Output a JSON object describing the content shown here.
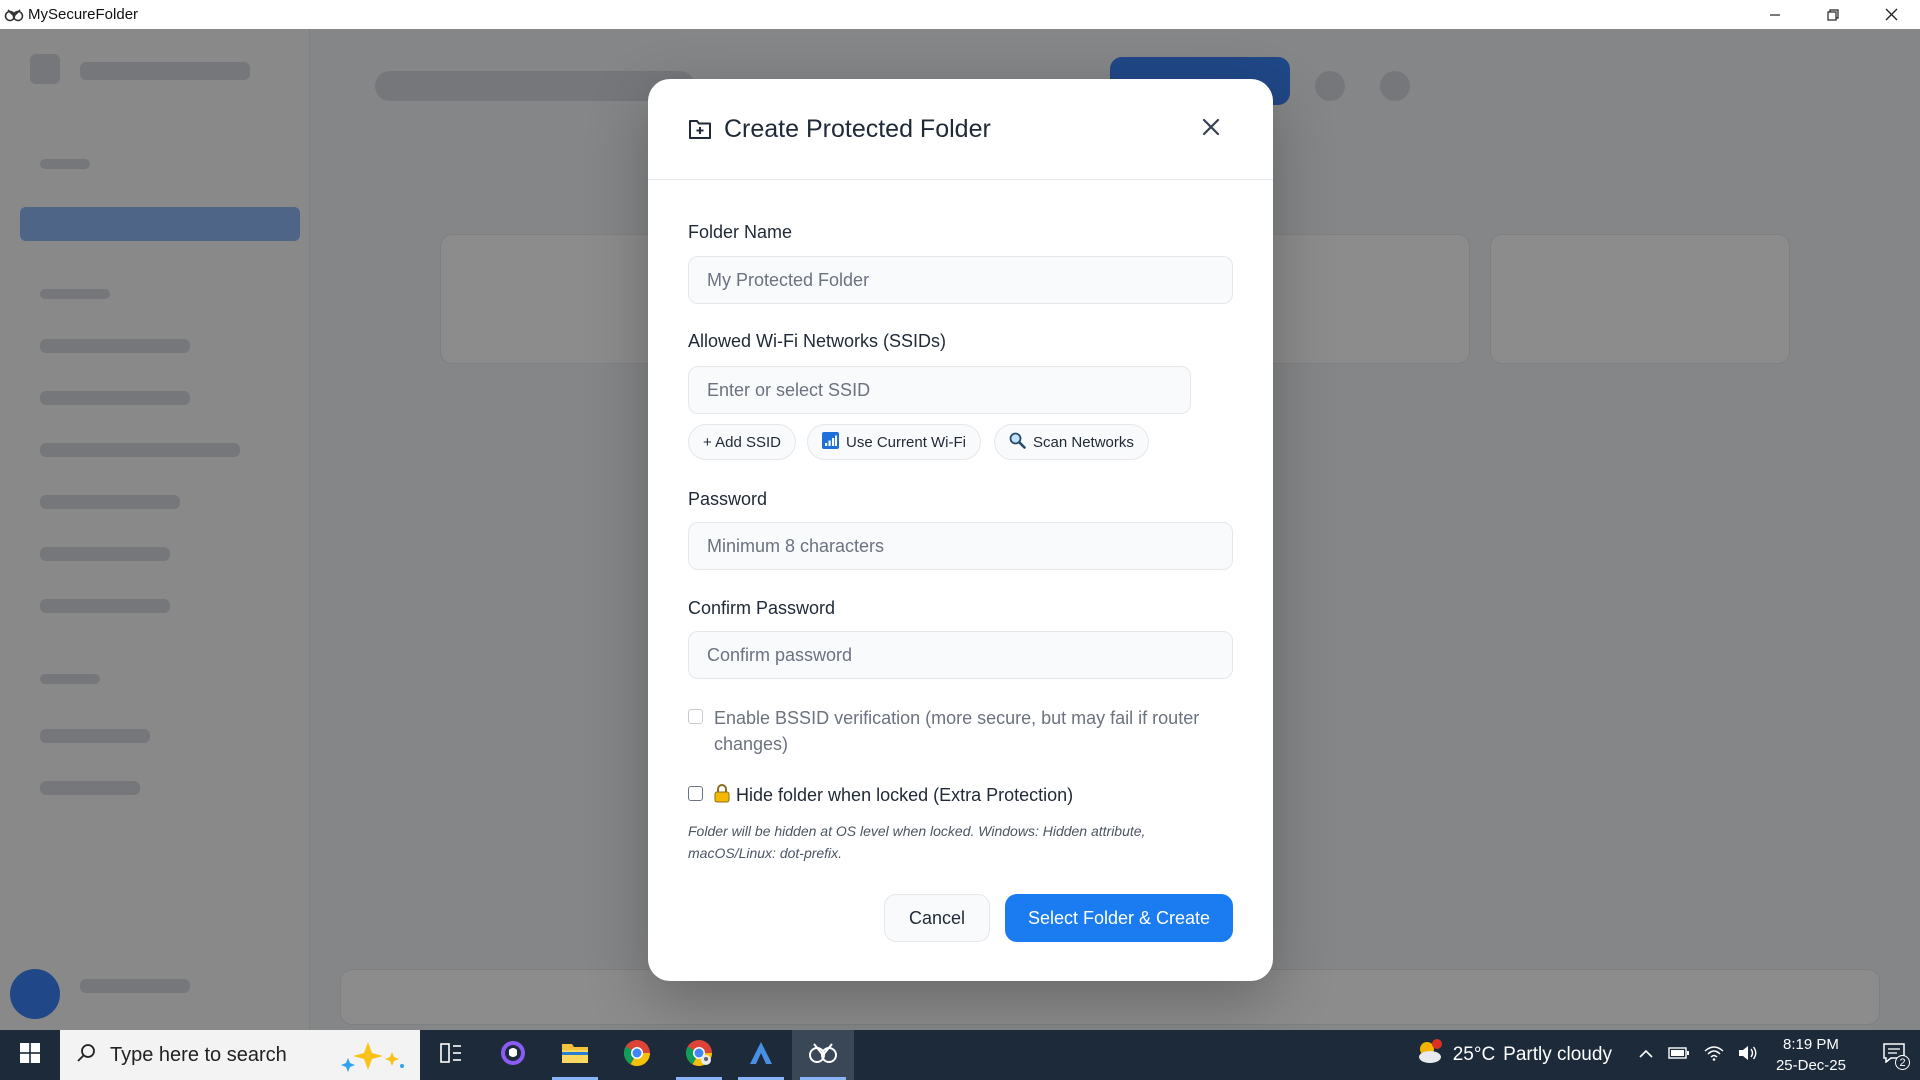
{
  "window": {
    "title": "MySecureFolder",
    "controls": {
      "minimize": "—",
      "maximize": "❐",
      "close": "✕"
    }
  },
  "modal": {
    "title": "Create Protected Folder",
    "folder_name": {
      "label": "Folder Name",
      "placeholder": "My Protected Folder"
    },
    "ssid": {
      "label": "Allowed Wi-Fi Networks (SSIDs)",
      "placeholder": "Enter or select SSID"
    },
    "ssid_actions": {
      "add": "+ Add SSID",
      "current": "Use Current Wi-Fi",
      "scan": "Scan Networks"
    },
    "password": {
      "label": "Password",
      "placeholder": "Minimum 8 characters"
    },
    "confirm_password": {
      "label": "Confirm Password",
      "placeholder": "Confirm password"
    },
    "bssid_option": {
      "label": "Enable BSSID verification (more secure, but may fail if router changes)",
      "checked": false,
      "disabled": true
    },
    "hide_option": {
      "label": "Hide folder when locked (Extra Protection)",
      "checked": false
    },
    "hide_hint": "Folder will be hidden at OS level when locked. Windows: Hidden attribute, macOS/Linux: dot-prefix.",
    "cancel_label": "Cancel",
    "submit_label": "Select Folder & Create",
    "accent_color": "#1a7cf0"
  },
  "taskbar": {
    "search_placeholder": "Type here to search",
    "apps": [
      "task-view",
      "github-desktop",
      "file-explorer",
      "chrome",
      "chrome-profile",
      "app-a",
      "mysecurefolder"
    ],
    "weather": {
      "temp": "25°C",
      "condition": "Partly cloudy",
      "badge": "5"
    },
    "time": "8:19 PM",
    "date": "25-Dec-25",
    "notification_count": "2"
  }
}
